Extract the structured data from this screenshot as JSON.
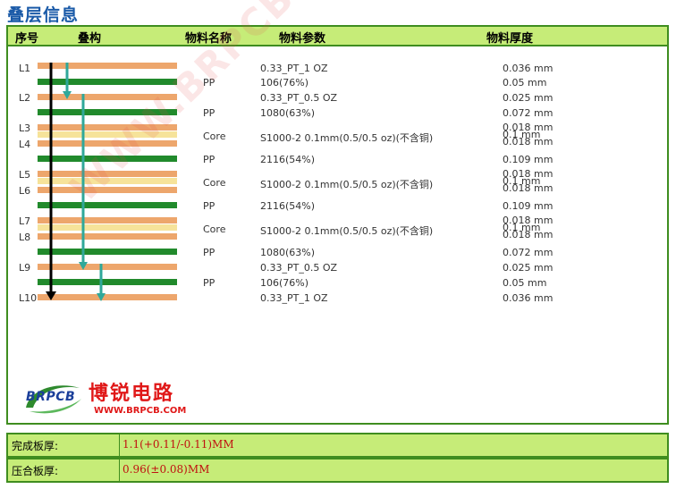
{
  "title": "叠层信息",
  "headers": {
    "seq": "序号",
    "stack": "叠构",
    "material_name": "物料名称",
    "material_param": "物料参数",
    "thickness": "物料厚度"
  },
  "rows": [
    {
      "layer": "L1",
      "name": "",
      "param": "0.33_PT_1 OZ",
      "thickness": "0.036 mm"
    },
    {
      "layer": "",
      "name": "PP",
      "param": "106(76%)",
      "thickness": "0.05 mm"
    },
    {
      "layer": "L2",
      "name": "",
      "param": "0.33_PT_0.5 OZ",
      "thickness": "0.025 mm"
    },
    {
      "layer": "",
      "name": "PP",
      "param": "1080(63%)",
      "thickness": "0.072 mm"
    },
    {
      "layer": "L3/L4",
      "name": "Core",
      "param": "S1000-2 0.1mm(0.5/0.5 oz)(不含铜)",
      "thickness": [
        "0.018 mm",
        "0.1 mm",
        "0.018 mm"
      ]
    },
    {
      "layer": "",
      "name": "PP",
      "param": "2116(54%)",
      "thickness": "0.109 mm"
    },
    {
      "layer": "L5/L6",
      "name": "Core",
      "param": "S1000-2 0.1mm(0.5/0.5 oz)(不含铜)",
      "thickness": [
        "0.018 mm",
        "0.1 mm",
        "0.018 mm"
      ]
    },
    {
      "layer": "",
      "name": "PP",
      "param": "2116(54%)",
      "thickness": "0.109 mm"
    },
    {
      "layer": "L7/L8",
      "name": "Core",
      "param": "S1000-2 0.1mm(0.5/0.5 oz)(不含铜)",
      "thickness": [
        "0.018 mm",
        "0.1 mm",
        "0.018 mm"
      ]
    },
    {
      "layer": "",
      "name": "PP",
      "param": "1080(63%)",
      "thickness": "0.072 mm"
    },
    {
      "layer": "L9",
      "name": "",
      "param": "0.33_PT_0.5 OZ",
      "thickness": "0.025 mm"
    },
    {
      "layer": "",
      "name": "PP",
      "param": "106(76%)",
      "thickness": "0.05 mm"
    },
    {
      "layer": "L10",
      "name": "",
      "param": "0.33_PT_1 OZ",
      "thickness": "0.036 mm"
    }
  ],
  "layer_labels": [
    "L1",
    "L2",
    "L3",
    "L4",
    "L5",
    "L6",
    "L7",
    "L8",
    "L9",
    "L10"
  ],
  "watermark": "WWW.BRPCB.COM",
  "logo": {
    "brand": "BRPCB",
    "cn_name": "博锐电路",
    "url": "WWW.BRPCB.COM"
  },
  "finished_thickness": {
    "label": "完成板厚:",
    "value": "1.1(+0.11/-0.11)MM"
  },
  "pressed_thickness": {
    "label": "压合板厚:",
    "value": "0.96(±0.08)MM"
  },
  "colors": {
    "header_bg": "#c6ec78",
    "border": "#3f8d1f",
    "copper": "#eda66c",
    "core": "#f6e39a",
    "prepreg": "#218a2c",
    "arrow": "#2fa89a",
    "title": "#1a5aa8",
    "value_red": "#c01010"
  }
}
